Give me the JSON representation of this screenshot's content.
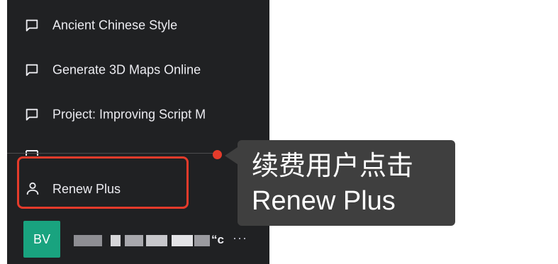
{
  "sidebar": {
    "chats": [
      {
        "label": "Ancient Chinese Style"
      },
      {
        "label": "Generate 3D Maps Online"
      },
      {
        "label": "Project: Improving Script M"
      }
    ],
    "renew": {
      "label": "Renew Plus"
    },
    "user": {
      "initials": "BV",
      "name_suffix": "“c",
      "more": "···"
    }
  },
  "tooltip": {
    "line1": "续费用户点击",
    "line2": "Renew Plus"
  },
  "colors": {
    "sidebar_bg": "#202123",
    "highlight_border": "#e53b2b",
    "avatar_bg": "#19a37f",
    "tooltip_bg": "#3f3f3f"
  }
}
